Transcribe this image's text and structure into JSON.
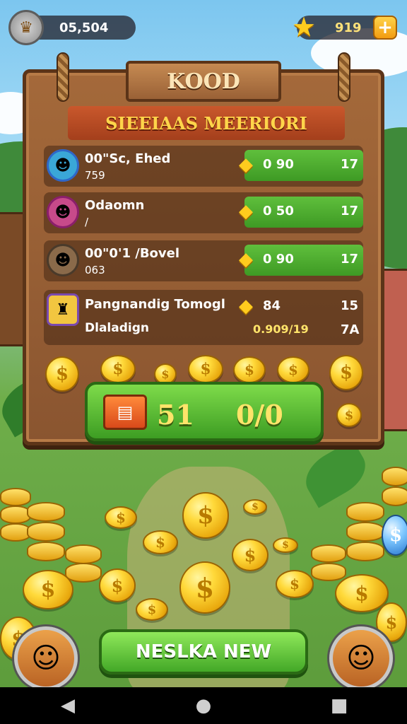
{
  "hud": {
    "score": "05,504",
    "star_count": "919",
    "avatar_icon": "crown-icon",
    "star_icon": "star-icon",
    "plus_label": "+"
  },
  "board": {
    "title": "KOOD",
    "banner": "SIEEIAAS MEERIORI",
    "rows": [
      {
        "name": "00\"Sc, Ehed",
        "sub": "759",
        "value": "0 90",
        "rank": "17"
      },
      {
        "name": "Odaomn",
        "sub": "/",
        "value": "0 50",
        "rank": "17"
      },
      {
        "name": "00\"0'1 /Bovel",
        "sub": "063",
        "value": "0 90",
        "rank": "17"
      },
      {
        "name": "Pangnandig Tomogl",
        "sub": "Dlaladign",
        "value": "84",
        "value2": "0.909/19",
        "rank": "15",
        "rank2": "7A"
      }
    ]
  },
  "reward_bar": {
    "value1": "51",
    "value2": "0/0",
    "chest_icon": "treasure-chest-icon"
  },
  "cta": {
    "label": "NESLKA NEW"
  },
  "colors": {
    "accent_green": "#43a827",
    "gold": "#ffd93a",
    "wood": "#8a5530",
    "banner_red": "#a43f1c"
  },
  "navbar": {
    "back": "◀",
    "home": "●",
    "recents": "■"
  }
}
